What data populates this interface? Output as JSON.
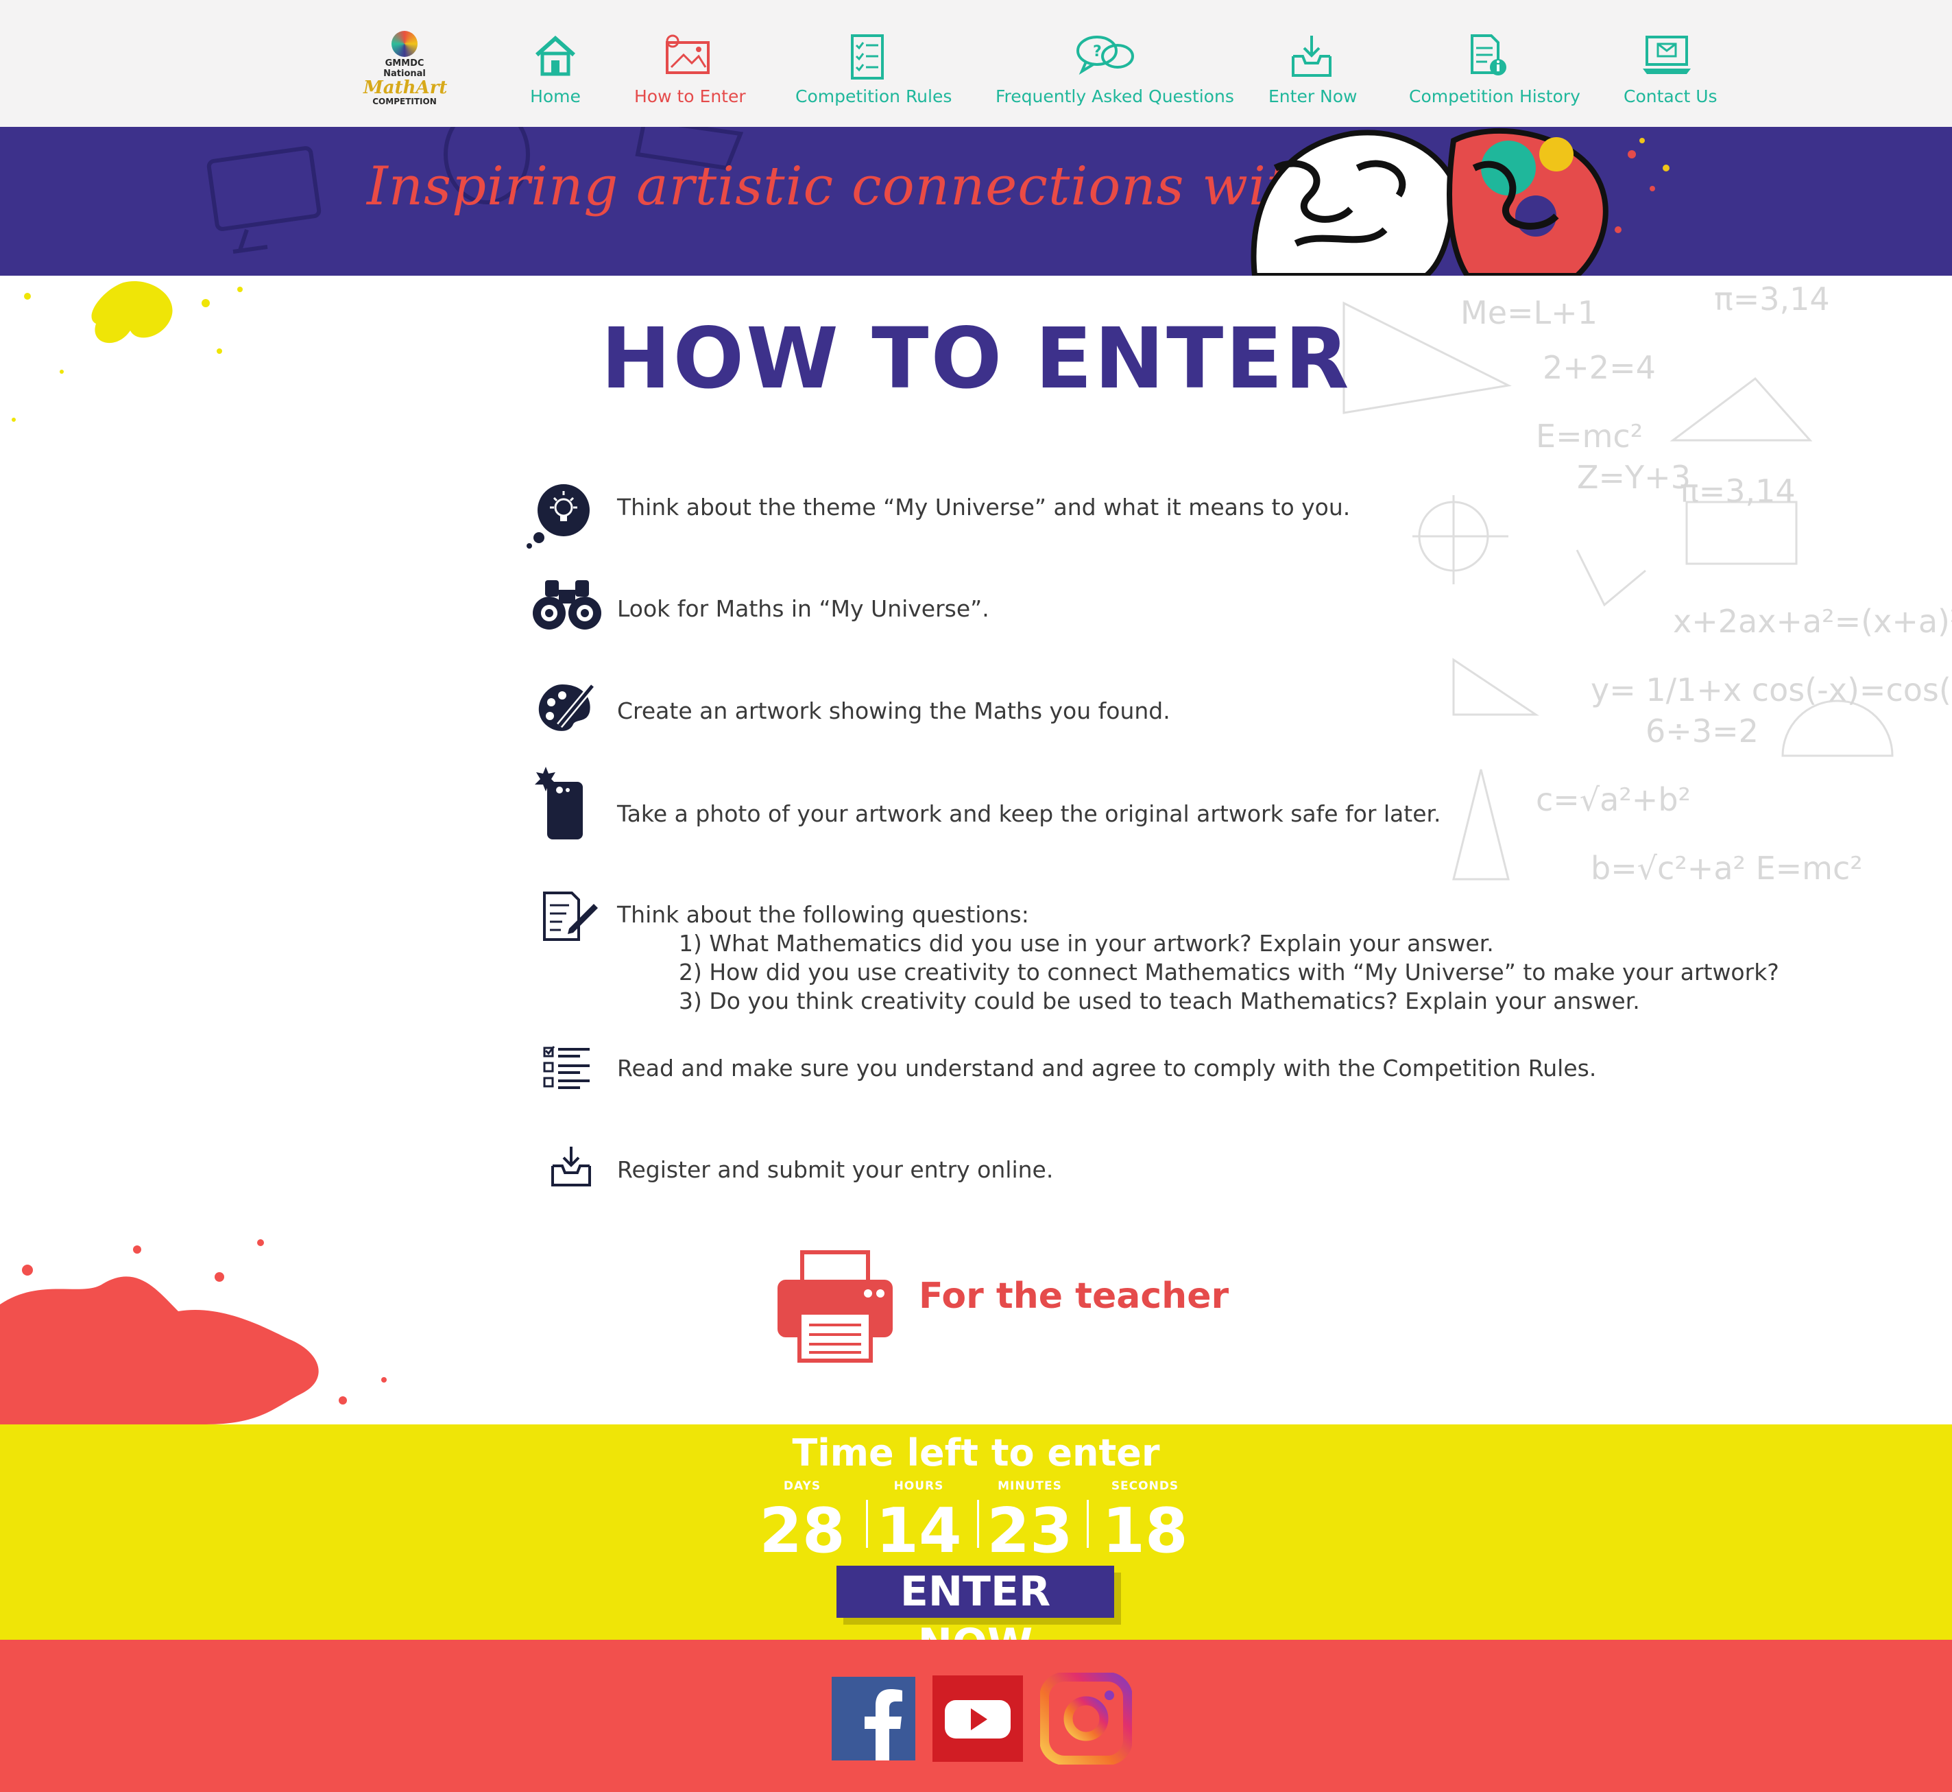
{
  "nav": {
    "logo": {
      "line1": "GMMDC National",
      "line2": "MathArt",
      "line3": "COMPETITION"
    },
    "items": [
      {
        "label": "Home",
        "icon": "house-icon"
      },
      {
        "label": "How to Enter",
        "icon": "drawing-board-icon",
        "active": true
      },
      {
        "label": "Competition Rules",
        "icon": "checklist-icon"
      },
      {
        "label": "Frequently Asked Questions",
        "icon": "speech-bubbles-icon"
      },
      {
        "label": "Enter Now",
        "icon": "inbox-download-icon"
      },
      {
        "label": "Competition History",
        "icon": "document-info-icon"
      },
      {
        "label": "Contact Us",
        "icon": "laptop-mail-icon"
      }
    ]
  },
  "banner": {
    "tagline": "Inspiring artistic connections with Maths"
  },
  "main": {
    "title": "HOW TO ENTER",
    "steps": [
      {
        "icon": "lightbulb-thought-icon",
        "text": "Think about the theme “My Universe” and what it means to you."
      },
      {
        "icon": "binoculars-icon",
        "text": "Look for Maths in “My Universe”."
      },
      {
        "icon": "palette-icon",
        "text": "Create an artwork showing the Maths you found."
      },
      {
        "icon": "phone-camera-icon",
        "text": "Take a photo of your artwork and keep the original artwork safe for later."
      },
      {
        "icon": "document-pen-icon",
        "text": "Think about the following questions:"
      },
      {
        "icon": "checklist-icon",
        "text": "Read and make sure you understand and agree to comply with the Competition Rules."
      },
      {
        "icon": "inbox-download-icon",
        "text": "Register and submit your entry online."
      }
    ],
    "questions": [
      "1) What Mathematics did you use in your artwork? Explain your answer.",
      "2) How did you use creativity to connect Mathematics with “My Universe” to make your artwork?",
      "3) Do you think creativity could be used to teach Mathematics? Explain your answer."
    ],
    "teacher_label": "For the teacher"
  },
  "countdown": {
    "title": "Time left to enter",
    "units": [
      {
        "label": "DAYS",
        "value": "28"
      },
      {
        "label": "HOURS",
        "value": "14"
      },
      {
        "label": "MINUTES",
        "value": "23"
      },
      {
        "label": "SECONDS",
        "value": "18"
      }
    ],
    "button": "ENTER NOW"
  },
  "footer": {
    "social": [
      "facebook-icon",
      "youtube-icon",
      "instagram-icon"
    ]
  },
  "colors": {
    "purple": "#3d318b",
    "red": "#e54b4b",
    "teal": "#1fb79b",
    "yellow": "#efe507",
    "footer_red": "#f2504d"
  }
}
